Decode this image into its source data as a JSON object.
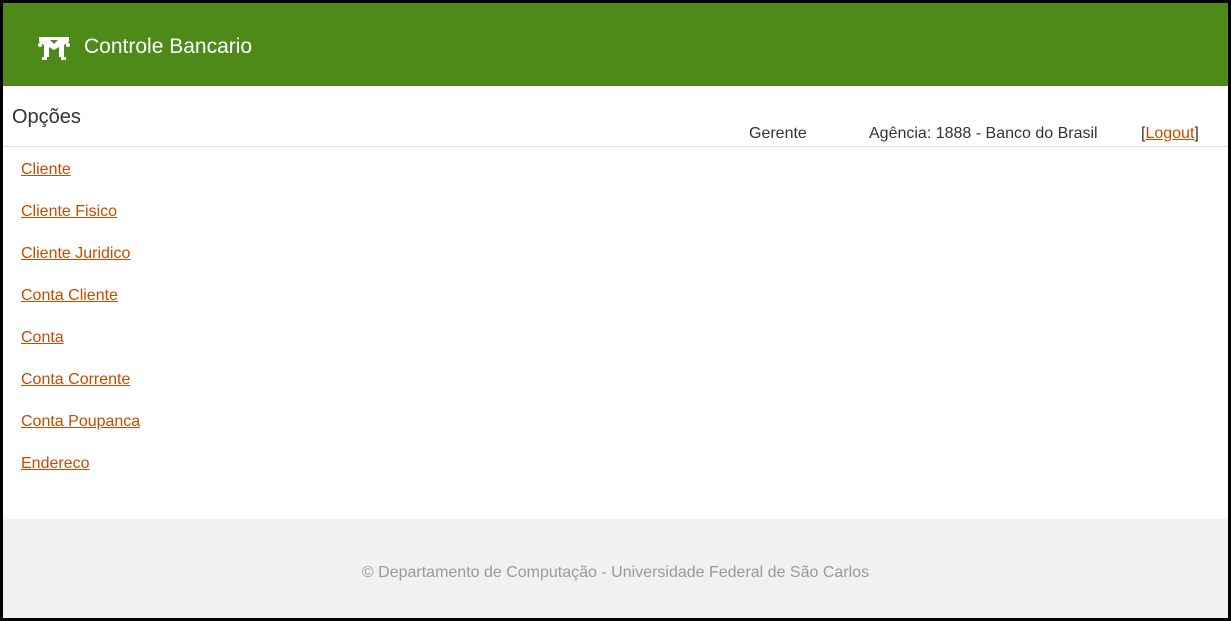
{
  "header": {
    "logo_icon": "bank-logo-icon",
    "title": "Controle Bancario",
    "background_color": "#4e8a18"
  },
  "options": {
    "title": "Opções"
  },
  "user": {
    "role": "Gerente",
    "agency": "Agência: 1888 - Banco do Brasil",
    "logout_open": "[",
    "logout_label": "Logout",
    "logout_close": "]"
  },
  "menu": {
    "items": [
      {
        "label": "Cliente"
      },
      {
        "label": "Cliente Fisico"
      },
      {
        "label": "Cliente Juridico"
      },
      {
        "label": "Conta Cliente"
      },
      {
        "label": "Conta"
      },
      {
        "label": "Conta Corrente"
      },
      {
        "label": "Conta Poupanca"
      },
      {
        "label": "Endereco"
      }
    ],
    "link_color": "#c84b00"
  },
  "footer": {
    "text": "© Departamento de Computação - Universidade Federal de São Carlos",
    "text_color": "#999999",
    "background_color": "#f1f1f1"
  }
}
